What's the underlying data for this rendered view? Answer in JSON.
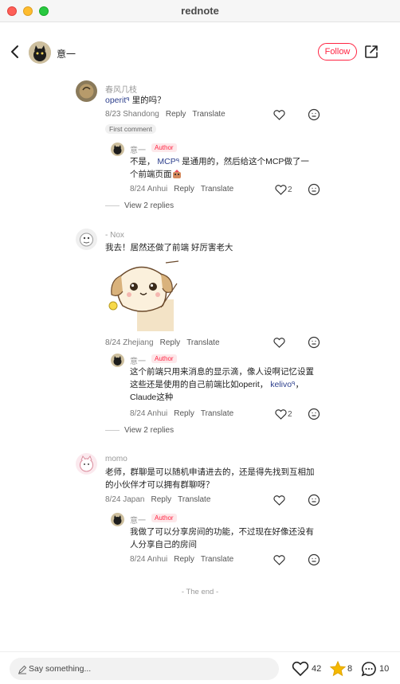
{
  "window": {
    "title": "rednote"
  },
  "header": {
    "author_name": "意一",
    "follow_label": "Follow"
  },
  "labels": {
    "reply": "Reply",
    "translate": "Translate",
    "first_comment": "First comment",
    "author": "Author"
  },
  "comments": [
    {
      "user": "春风几枝",
      "text_pre": "",
      "mention1": "operit",
      "text_post": "里的吗？",
      "date_loc": "8/23 Shandong",
      "reply": {
        "user": "意一",
        "line1_pre": "不是，",
        "mention": "MCP",
        "line1_post": "是通用的，然后给这个MCP做了一",
        "line2": "个前端页面",
        "date_loc": "8/24 Anhui",
        "likes": "2"
      },
      "view_replies": "View 2 replies"
    },
    {
      "user": "- Nox",
      "text": "我去！居然还做了前端 好厉害老大",
      "date_loc": "8/24 Zhejiang",
      "reply": {
        "user": "意一",
        "line1": "这个前端只用来消息的显示滴，像人设啊记忆设置",
        "line2_pre": "这些还是使用的自己前端比如operit，",
        "mention": "kelivo",
        "line2_post": "，",
        "line3": "Claude这种",
        "date_loc": "8/24 Anhui",
        "likes": "2"
      },
      "view_replies": "View 2 replies"
    },
    {
      "user": "momo",
      "line1": "老师，群聊是可以随机申请进去的，还是得先找到互相加",
      "line2": "的小伙伴才可以拥有群聊呀？",
      "date_loc": "8/24 Japan",
      "reply": {
        "user": "意一",
        "line1": "我做了可以分享房间的功能，不过现在好像还没有",
        "line2": "人分享自己的房间",
        "date_loc": "8/24 Anhui"
      }
    }
  ],
  "the_end": "- The end -",
  "bottom": {
    "placeholder": "Say something...",
    "likes": "42",
    "collects": "8",
    "comments": "10"
  },
  "colors": {
    "brand": "#ff2442",
    "mention": "#2c3e8c",
    "star": "#f5b800"
  },
  "icons": [
    "back-icon",
    "share-icon",
    "heart-icon",
    "emoji-face-icon",
    "pen-icon",
    "star-icon",
    "comment-bubble-icon"
  ]
}
